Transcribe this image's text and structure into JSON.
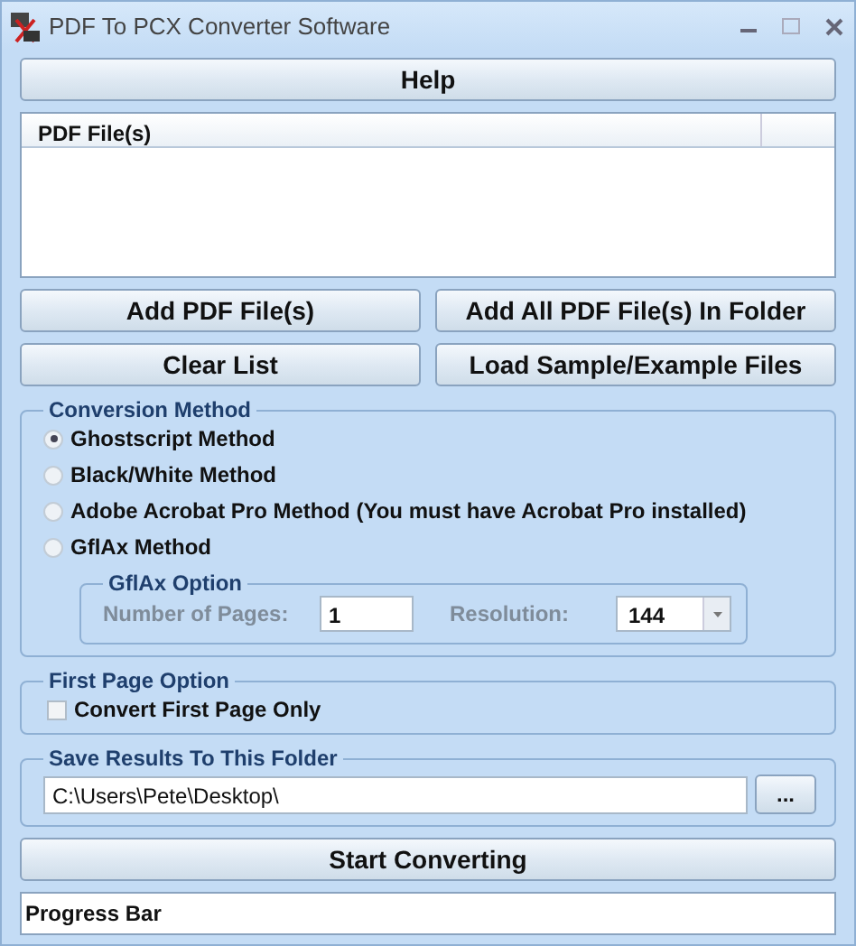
{
  "window": {
    "title": "PDF To PCX Converter Software"
  },
  "help_button": "Help",
  "file_list": {
    "columns": [
      "PDF File(s)"
    ]
  },
  "buttons_row_1": [
    "Add PDF File(s)",
    "Add All PDF File(s) In Folder"
  ],
  "buttons_row_2": [
    "Clear List",
    "Load Sample/Example Files"
  ],
  "conversion_method": {
    "title": "Conversion Method",
    "options": [
      {
        "label": "Ghostscript Method",
        "selected": true
      },
      {
        "label": "Black/White Method",
        "selected": false
      },
      {
        "label": "Adobe Acrobat Pro Method (You must have Acrobat Pro installed)",
        "selected": false
      },
      {
        "label": "GflAx Method",
        "selected": false
      }
    ],
    "gflax_option": {
      "title": "GflAx Option",
      "disabled": true,
      "pages_label": "Number of Pages:",
      "pages_value": "1",
      "resolution_label": "Resolution:",
      "resolution_value": "144"
    }
  },
  "first_page_option": {
    "title": "First Page Option",
    "label": "Convert First Page Only",
    "checked": false
  },
  "save_folder": {
    "title": "Save Results To This Folder",
    "value": "C:\\Users\\Pete\\Desktop\\",
    "browse": "..."
  },
  "start_button": "Start Converting",
  "progress": {
    "label": "Progress Bar"
  }
}
